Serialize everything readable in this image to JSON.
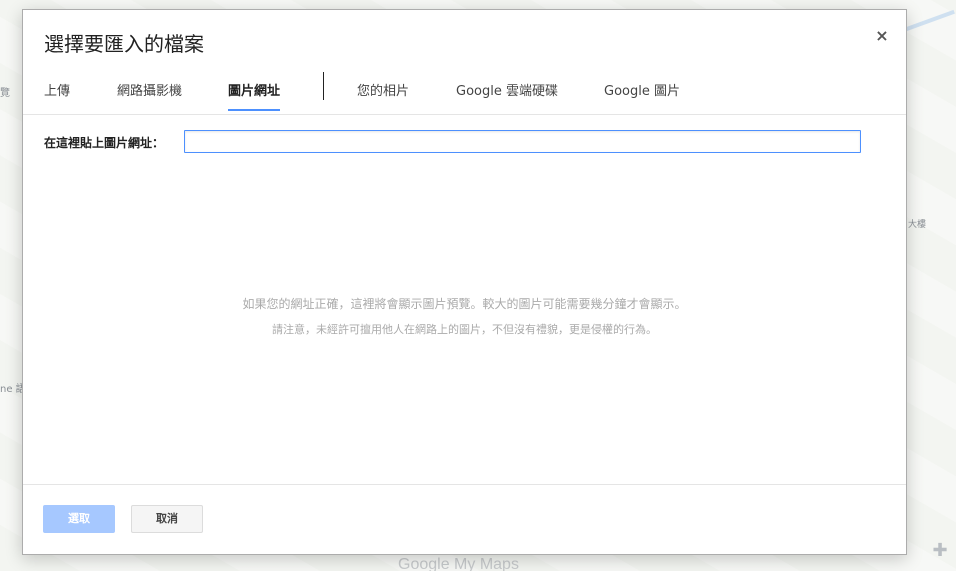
{
  "background": {
    "left_label_1": "覽",
    "left_label_2": "ne 語",
    "right_label": "大樓",
    "brand": "Google My Maps"
  },
  "dialog": {
    "title": "選擇要匯入的檔案",
    "close_symbol": "×",
    "tabs": [
      {
        "label": "上傳",
        "active": false
      },
      {
        "label": "網路攝影機",
        "active": false
      },
      {
        "label": "圖片網址",
        "active": true
      },
      {
        "label": "您的相片",
        "active": false
      },
      {
        "label": "Google 雲端硬碟",
        "active": false
      },
      {
        "label": "Google 圖片",
        "active": false
      }
    ],
    "url_label": "在這裡貼上圖片網址：",
    "url_value": "",
    "info_line_1": "如果您的網址正確，這裡將會顯示圖片預覽。較大的圖片可能需要幾分鐘才會顯示。",
    "info_line_2": "請注意，未經許可擅用他人在網路上的圖片，不但沒有禮貌，更是侵權的行為。",
    "buttons": {
      "select": "選取",
      "cancel": "取消"
    }
  }
}
